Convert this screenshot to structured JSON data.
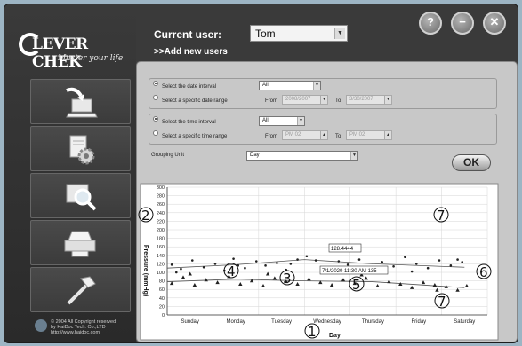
{
  "logo": {
    "text": "LEVER CHEK",
    "tagline": "Master your life"
  },
  "copyright": [
    "© 2004 All Copyright reserved",
    "by HaiDoc Tech. Co.,LTD",
    "http://www.haidoc.com"
  ],
  "header": {
    "user_label": "Current user:",
    "user_value": "Tom",
    "add_user_label": ">>Add new users"
  },
  "window_buttons": [
    {
      "name": "help-button",
      "glyph": "?"
    },
    {
      "name": "minimize-button",
      "glyph": "−"
    },
    {
      "name": "close-button",
      "glyph": "✕"
    }
  ],
  "nav": [
    {
      "name": "nav-item-download",
      "icon": "laptop-download-icon"
    },
    {
      "name": "nav-item-settings",
      "icon": "document-gear-icon"
    },
    {
      "name": "nav-item-search",
      "icon": "magnifier-icon"
    },
    {
      "name": "nav-item-print",
      "icon": "printer-icon"
    },
    {
      "name": "nav-item-tools",
      "icon": "hammer-icon"
    }
  ],
  "filters": {
    "date_interval_label": "Select the date interval",
    "date_interval_value": "All",
    "date_range_label": "Select a specific date range",
    "date_from_label": "From",
    "date_from_value": "2008/2007",
    "date_to_label": "To",
    "date_to_value": "3/30/2007",
    "time_interval_label": "Select the time interval",
    "time_interval_value": "All",
    "time_range_label": "Select a specific time range",
    "time_from_label": "From",
    "time_from_value": "PM 02",
    "time_to_label": "To",
    "time_to_value": "PM 02",
    "grouping_label": "Grouping Unit",
    "grouping_value": "Day",
    "ok_label": "OK"
  },
  "chart_data": {
    "type": "scatter",
    "ylabel": "Pressure (mmHg)",
    "xlabel": "Day",
    "ylim": [
      0,
      300
    ],
    "yticks": [
      0,
      20,
      40,
      60,
      80,
      100,
      120,
      140,
      160,
      180,
      200,
      220,
      240,
      260,
      280,
      300
    ],
    "categories": [
      "Sunday",
      "Monday",
      "Tuesday",
      "Wednesday",
      "Thursday",
      "Friday",
      "Saturday"
    ],
    "grid": true,
    "series": [
      {
        "marker": "circle",
        "points": [
          [
            0.1,
            118
          ],
          [
            0.3,
            108
          ],
          [
            0.55,
            128
          ],
          [
            0.8,
            112
          ],
          [
            1.05,
            120
          ],
          [
            1.25,
            104
          ],
          [
            1.45,
            132
          ],
          [
            1.7,
            110
          ],
          [
            1.95,
            126
          ],
          [
            2.15,
            116
          ],
          [
            2.4,
            122
          ],
          [
            2.6,
            106
          ],
          [
            2.85,
            130
          ],
          [
            3.05,
            138
          ],
          [
            3.25,
            128
          ],
          [
            3.5,
            112
          ],
          [
            3.75,
            126
          ],
          [
            3.95,
            118
          ],
          [
            4.2,
            130
          ],
          [
            4.45,
            108
          ],
          [
            4.7,
            124
          ],
          [
            4.95,
            114
          ],
          [
            5.2,
            136
          ],
          [
            5.45,
            120
          ],
          [
            5.7,
            110
          ],
          [
            5.95,
            128
          ],
          [
            6.2,
            116
          ],
          [
            6.45,
            124
          ],
          [
            0.2,
            100
          ],
          [
            1.55,
            116
          ],
          [
            2.7,
            120
          ],
          [
            4.05,
            100
          ],
          [
            5.35,
            102
          ],
          [
            6.35,
            130
          ]
        ],
        "trend": [
          [
            0,
            110
          ],
          [
            1.5,
            118
          ],
          [
            3,
            130
          ],
          [
            4.5,
            120
          ],
          [
            6.5,
            112
          ]
        ]
      },
      {
        "marker": "triangle",
        "points": [
          [
            0.1,
            74
          ],
          [
            0.35,
            88
          ],
          [
            0.6,
            70
          ],
          [
            0.85,
            82
          ],
          [
            1.1,
            76
          ],
          [
            1.35,
            90
          ],
          [
            1.6,
            72
          ],
          [
            1.85,
            80
          ],
          [
            2.1,
            68
          ],
          [
            2.35,
            86
          ],
          [
            2.6,
            78
          ],
          [
            2.85,
            72
          ],
          [
            3.1,
            84
          ],
          [
            3.35,
            76
          ],
          [
            3.6,
            70
          ],
          [
            3.85,
            82
          ],
          [
            4.1,
            74
          ],
          [
            4.35,
            86
          ],
          [
            4.6,
            68
          ],
          [
            4.85,
            78
          ],
          [
            5.1,
            72
          ],
          [
            5.35,
            64
          ],
          [
            5.6,
            76
          ],
          [
            5.85,
            70
          ],
          [
            6.1,
            66
          ],
          [
            6.35,
            58
          ],
          [
            6.55,
            68
          ],
          [
            0.5,
            96
          ],
          [
            2.2,
            96
          ],
          [
            4.25,
            94
          ],
          [
            5.9,
            58
          ]
        ],
        "trend": [
          [
            0,
            78
          ],
          [
            1.5,
            84
          ],
          [
            3,
            80
          ],
          [
            4.5,
            78
          ],
          [
            6.5,
            64
          ]
        ]
      }
    ],
    "labels": [
      "128.4444",
      "7/1/2020 11:30 AM 135"
    ],
    "annotations": [
      "1",
      "2",
      "3",
      "4",
      "5",
      "6",
      "7",
      "7"
    ]
  }
}
